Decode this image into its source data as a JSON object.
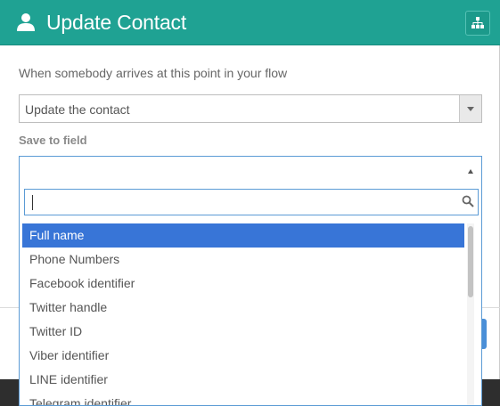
{
  "header": {
    "title": "Update Contact",
    "icon": "user-icon",
    "flow_icon": "sitemap-icon",
    "color": "#1fa293"
  },
  "intro_text": "When somebody arrives at this point in your flow",
  "action_select": {
    "value": "Update the contact"
  },
  "save_label": "Save to field",
  "field_select": {
    "value": "",
    "search_value": ""
  },
  "options": [
    {
      "label": "Full name",
      "selected": true
    },
    {
      "label": "Phone Numbers",
      "selected": false
    },
    {
      "label": "Facebook identifier",
      "selected": false
    },
    {
      "label": "Twitter handle",
      "selected": false
    },
    {
      "label": "Twitter ID",
      "selected": false
    },
    {
      "label": "Viber identifier",
      "selected": false
    },
    {
      "label": "LINE identifier",
      "selected": false
    },
    {
      "label": "Telegram identifier",
      "selected": false
    }
  ],
  "colors": {
    "accent": "#1fa293",
    "highlight": "#3875d7",
    "focus": "#5b9bd5"
  }
}
